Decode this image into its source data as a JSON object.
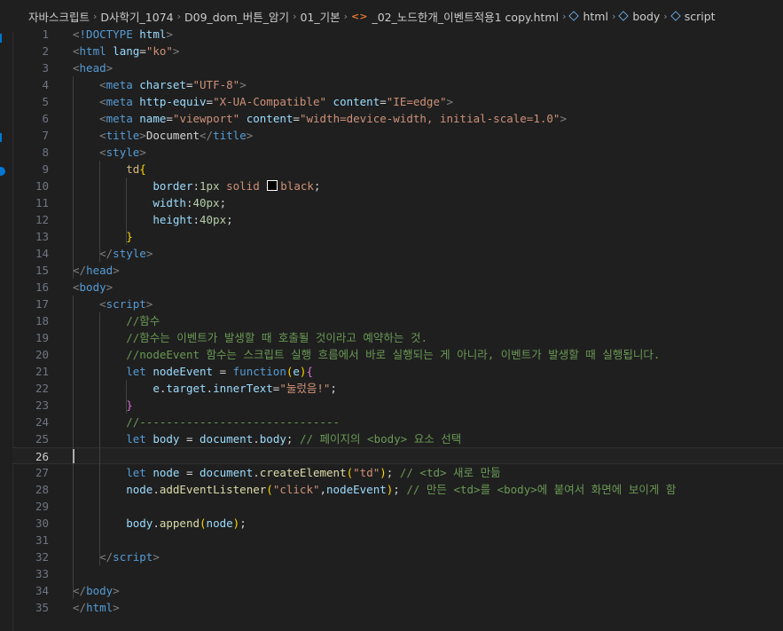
{
  "breadcrumb": {
    "segments": [
      "자바스크립트",
      "D사학기_1074",
      "D09_dom_버튼_암기",
      "01_기본"
    ],
    "file": "_02_노드한개_이벤트적용1 copy.html",
    "symbols": [
      "html",
      "body",
      "script"
    ]
  },
  "editor": {
    "active_line": 26,
    "lines": [
      {
        "n": "1",
        "t": [
          [
            "t-punct",
            "<"
          ],
          [
            "t-tag",
            "!DOCTYPE"
          ],
          [
            "t-text",
            " "
          ],
          [
            "t-attr",
            "html"
          ],
          [
            "t-punct",
            ">"
          ]
        ]
      },
      {
        "n": "2",
        "t": [
          [
            "t-punct",
            "<"
          ],
          [
            "t-tag",
            "html"
          ],
          [
            "t-text",
            " "
          ],
          [
            "t-attr",
            "lang"
          ],
          [
            "t-text",
            "="
          ],
          [
            "t-str",
            "\"ko\""
          ],
          [
            "t-punct",
            ">"
          ]
        ]
      },
      {
        "n": "3",
        "t": [
          [
            "t-punct",
            "<"
          ],
          [
            "t-tag",
            "head"
          ],
          [
            "t-punct",
            ">"
          ]
        ]
      },
      {
        "n": "4",
        "t": [
          [
            "t-text",
            "    "
          ],
          [
            "t-punct",
            "<"
          ],
          [
            "t-tag",
            "meta"
          ],
          [
            "t-text",
            " "
          ],
          [
            "t-attr",
            "charset"
          ],
          [
            "t-text",
            "="
          ],
          [
            "t-str",
            "\"UTF-8\""
          ],
          [
            "t-punct",
            ">"
          ]
        ]
      },
      {
        "n": "5",
        "t": [
          [
            "t-text",
            "    "
          ],
          [
            "t-punct",
            "<"
          ],
          [
            "t-tag",
            "meta"
          ],
          [
            "t-text",
            " "
          ],
          [
            "t-attr",
            "http-equiv"
          ],
          [
            "t-text",
            "="
          ],
          [
            "t-str",
            "\"X-UA-Compatible\""
          ],
          [
            "t-text",
            " "
          ],
          [
            "t-attr",
            "content"
          ],
          [
            "t-text",
            "="
          ],
          [
            "t-str",
            "\"IE=edge\""
          ],
          [
            "t-punct",
            ">"
          ]
        ]
      },
      {
        "n": "6",
        "t": [
          [
            "t-text",
            "    "
          ],
          [
            "t-punct",
            "<"
          ],
          [
            "t-tag",
            "meta"
          ],
          [
            "t-text",
            " "
          ],
          [
            "t-attr",
            "name"
          ],
          [
            "t-text",
            "="
          ],
          [
            "t-str",
            "\"viewport\""
          ],
          [
            "t-text",
            " "
          ],
          [
            "t-attr",
            "content"
          ],
          [
            "t-text",
            "="
          ],
          [
            "t-str",
            "\"width=device-width, initial-scale=1.0\""
          ],
          [
            "t-punct",
            ">"
          ]
        ]
      },
      {
        "n": "7",
        "t": [
          [
            "t-text",
            "    "
          ],
          [
            "t-punct",
            "<"
          ],
          [
            "t-tag",
            "title"
          ],
          [
            "t-punct",
            ">"
          ],
          [
            "t-text",
            "Document"
          ],
          [
            "t-punct",
            "</"
          ],
          [
            "t-tag",
            "title"
          ],
          [
            "t-punct",
            ">"
          ]
        ]
      },
      {
        "n": "8",
        "t": [
          [
            "t-text",
            "    "
          ],
          [
            "t-punct",
            "<"
          ],
          [
            "t-tag",
            "style"
          ],
          [
            "t-punct",
            ">"
          ]
        ]
      },
      {
        "n": "9",
        "t": [
          [
            "t-text",
            "        "
          ],
          [
            "t-sel",
            "td"
          ],
          [
            "t-brace",
            "{"
          ]
        ]
      },
      {
        "n": "10",
        "t": [
          [
            "t-text",
            "            "
          ],
          [
            "t-prop",
            "border"
          ],
          [
            "t-text",
            ":"
          ],
          [
            "t-num",
            "1px"
          ],
          [
            "t-text",
            " "
          ],
          [
            "t-val",
            "solid"
          ],
          [
            "t-text",
            " "
          ],
          [
            "swatch",
            ""
          ],
          [
            "t-val",
            "black"
          ],
          [
            "t-text",
            ";"
          ]
        ]
      },
      {
        "n": "11",
        "t": [
          [
            "t-text",
            "            "
          ],
          [
            "t-prop",
            "width"
          ],
          [
            "t-text",
            ":"
          ],
          [
            "t-num",
            "40px"
          ],
          [
            "t-text",
            ";"
          ]
        ]
      },
      {
        "n": "12",
        "t": [
          [
            "t-text",
            "            "
          ],
          [
            "t-prop",
            "height"
          ],
          [
            "t-text",
            ":"
          ],
          [
            "t-num",
            "40px"
          ],
          [
            "t-text",
            ";"
          ]
        ]
      },
      {
        "n": "13",
        "t": [
          [
            "t-text",
            "        "
          ],
          [
            "t-brace",
            "}"
          ]
        ]
      },
      {
        "n": "14",
        "t": [
          [
            "t-text",
            "    "
          ],
          [
            "t-punct",
            "</"
          ],
          [
            "t-tag",
            "style"
          ],
          [
            "t-punct",
            ">"
          ]
        ]
      },
      {
        "n": "15",
        "t": [
          [
            "t-punct",
            "</"
          ],
          [
            "t-tag",
            "head"
          ],
          [
            "t-punct",
            ">"
          ]
        ]
      },
      {
        "n": "16",
        "t": [
          [
            "t-punct",
            "<"
          ],
          [
            "t-tag",
            "body"
          ],
          [
            "t-punct",
            ">"
          ]
        ]
      },
      {
        "n": "17",
        "t": [
          [
            "t-text",
            "    "
          ],
          [
            "t-punct",
            "<"
          ],
          [
            "t-tag",
            "script"
          ],
          [
            "t-punct",
            ">"
          ]
        ]
      },
      {
        "n": "18",
        "t": [
          [
            "t-text",
            "        "
          ],
          [
            "t-cmt",
            "//함수"
          ]
        ]
      },
      {
        "n": "19",
        "t": [
          [
            "t-text",
            "        "
          ],
          [
            "t-cmt",
            "//함수는 이벤트가 발생할 때 호출될 것이라고 예약하는 것."
          ]
        ]
      },
      {
        "n": "20",
        "t": [
          [
            "t-text",
            "        "
          ],
          [
            "t-cmt",
            "//nodeEvent 함수는 스크립트 실행 흐름에서 바로 실행되는 게 아니라, 이벤트가 발생할 때 실행됩니다."
          ]
        ]
      },
      {
        "n": "21",
        "t": [
          [
            "t-text",
            "        "
          ],
          [
            "t-kw",
            "let"
          ],
          [
            "t-text",
            " "
          ],
          [
            "t-var",
            "nodeEvent"
          ],
          [
            "t-text",
            " = "
          ],
          [
            "t-kw",
            "function"
          ],
          [
            "t-brace",
            "("
          ],
          [
            "t-var",
            "e"
          ],
          [
            "t-brace",
            ")"
          ],
          [
            "t-brace2",
            "{"
          ]
        ]
      },
      {
        "n": "22",
        "t": [
          [
            "t-text",
            "            "
          ],
          [
            "t-var",
            "e"
          ],
          [
            "t-text",
            "."
          ],
          [
            "t-var",
            "target"
          ],
          [
            "t-text",
            "."
          ],
          [
            "t-var",
            "innerText"
          ],
          [
            "t-text",
            "="
          ],
          [
            "t-str",
            "\"눌렀음!\""
          ],
          [
            "t-text",
            ";"
          ]
        ]
      },
      {
        "n": "23",
        "t": [
          [
            "t-text",
            "        "
          ],
          [
            "t-brace2",
            "}"
          ]
        ]
      },
      {
        "n": "24",
        "t": [
          [
            "t-text",
            "        "
          ],
          [
            "t-cmt",
            "//------------------------------"
          ]
        ]
      },
      {
        "n": "25",
        "t": [
          [
            "t-text",
            "        "
          ],
          [
            "t-kw",
            "let"
          ],
          [
            "t-text",
            " "
          ],
          [
            "t-var",
            "body"
          ],
          [
            "t-text",
            " = "
          ],
          [
            "t-var",
            "document"
          ],
          [
            "t-text",
            "."
          ],
          [
            "t-var",
            "body"
          ],
          [
            "t-text",
            "; "
          ],
          [
            "t-cmt",
            "// 페이지의 <body> 요소 선택"
          ]
        ]
      },
      {
        "n": "26",
        "t": []
      },
      {
        "n": "27",
        "t": [
          [
            "t-text",
            "        "
          ],
          [
            "t-kw",
            "let"
          ],
          [
            "t-text",
            " "
          ],
          [
            "t-var",
            "node"
          ],
          [
            "t-text",
            " = "
          ],
          [
            "t-var",
            "document"
          ],
          [
            "t-text",
            "."
          ],
          [
            "t-fn",
            "createElement"
          ],
          [
            "t-brace",
            "("
          ],
          [
            "t-str",
            "\"td\""
          ],
          [
            "t-brace",
            ")"
          ],
          [
            "t-text",
            "; "
          ],
          [
            "t-cmt",
            "// <td> 새로 만듦"
          ]
        ]
      },
      {
        "n": "28",
        "t": [
          [
            "t-text",
            "        "
          ],
          [
            "t-var",
            "node"
          ],
          [
            "t-text",
            "."
          ],
          [
            "t-fn",
            "addEventListener"
          ],
          [
            "t-brace",
            "("
          ],
          [
            "t-str",
            "\"click\""
          ],
          [
            "t-text",
            ","
          ],
          [
            "t-var",
            "nodeEvent"
          ],
          [
            "t-brace",
            ")"
          ],
          [
            "t-text",
            "; "
          ],
          [
            "t-cmt",
            "// 만든 <td>를 <body>에 붙여서 화면에 보이게 함"
          ]
        ]
      },
      {
        "n": "29",
        "t": []
      },
      {
        "n": "30",
        "t": [
          [
            "t-text",
            "        "
          ],
          [
            "t-var",
            "body"
          ],
          [
            "t-text",
            "."
          ],
          [
            "t-fn",
            "append"
          ],
          [
            "t-brace",
            "("
          ],
          [
            "t-var",
            "node"
          ],
          [
            "t-brace",
            ")"
          ],
          [
            "t-text",
            ";"
          ]
        ]
      },
      {
        "n": "31",
        "t": []
      },
      {
        "n": "32",
        "t": [
          [
            "t-text",
            "    "
          ],
          [
            "t-punct",
            "</"
          ],
          [
            "t-tag",
            "script"
          ],
          [
            "t-punct",
            ">"
          ]
        ]
      },
      {
        "n": "33",
        "t": []
      },
      {
        "n": "34",
        "t": [
          [
            "t-punct",
            "</"
          ],
          [
            "t-tag",
            "body"
          ],
          [
            "t-punct",
            ">"
          ]
        ]
      },
      {
        "n": "35",
        "t": [
          [
            "t-punct",
            "</"
          ],
          [
            "t-tag",
            "html"
          ],
          [
            "t-punct",
            ">"
          ]
        ]
      }
    ]
  }
}
